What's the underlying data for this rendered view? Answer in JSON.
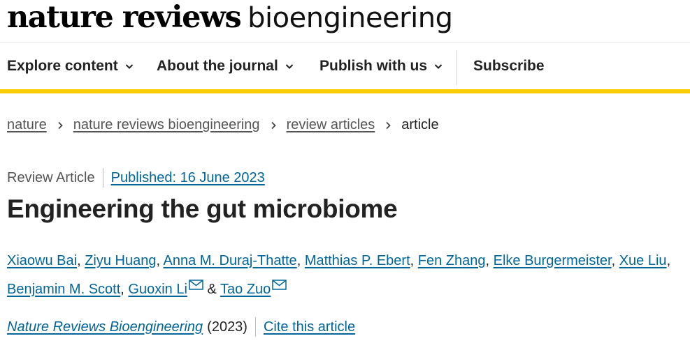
{
  "brand": {
    "name_bold": "nature reviews",
    "name_light": "bioengineering"
  },
  "nav": {
    "items": [
      {
        "label": "Explore content",
        "icon": "chevron-down-icon"
      },
      {
        "label": "About the journal",
        "icon": "chevron-down-icon"
      },
      {
        "label": "Publish with us",
        "icon": "chevron-down-icon"
      }
    ],
    "subscribe": "Subscribe"
  },
  "breadcrumb": {
    "items": [
      "nature",
      "nature reviews bioengineering",
      "review articles"
    ],
    "current": "article",
    "separator_icon": "chevron-right-icon"
  },
  "article": {
    "type": "Review Article",
    "published": "Published: 16 June 2023",
    "title": "Engineering the gut microbiome",
    "authors": [
      "Xiaowu Bai",
      "Ziyu Huang",
      "Anna M. Duraj-Thatte",
      "Matthias P. Ebert",
      "Fen Zhang",
      "Elke Burgermeister",
      "Xue Liu",
      "Benjamin M. Scott",
      "Guoxin Li",
      "Tao Zuo"
    ],
    "author_separator": ",",
    "author_conjunction": "&",
    "journal": "Nature Reviews Bioengineering",
    "year": "(2023)",
    "cite": "Cite this article"
  },
  "colors": {
    "link": "#006699",
    "accent_bar": "#fccc00",
    "text": "#222222"
  }
}
